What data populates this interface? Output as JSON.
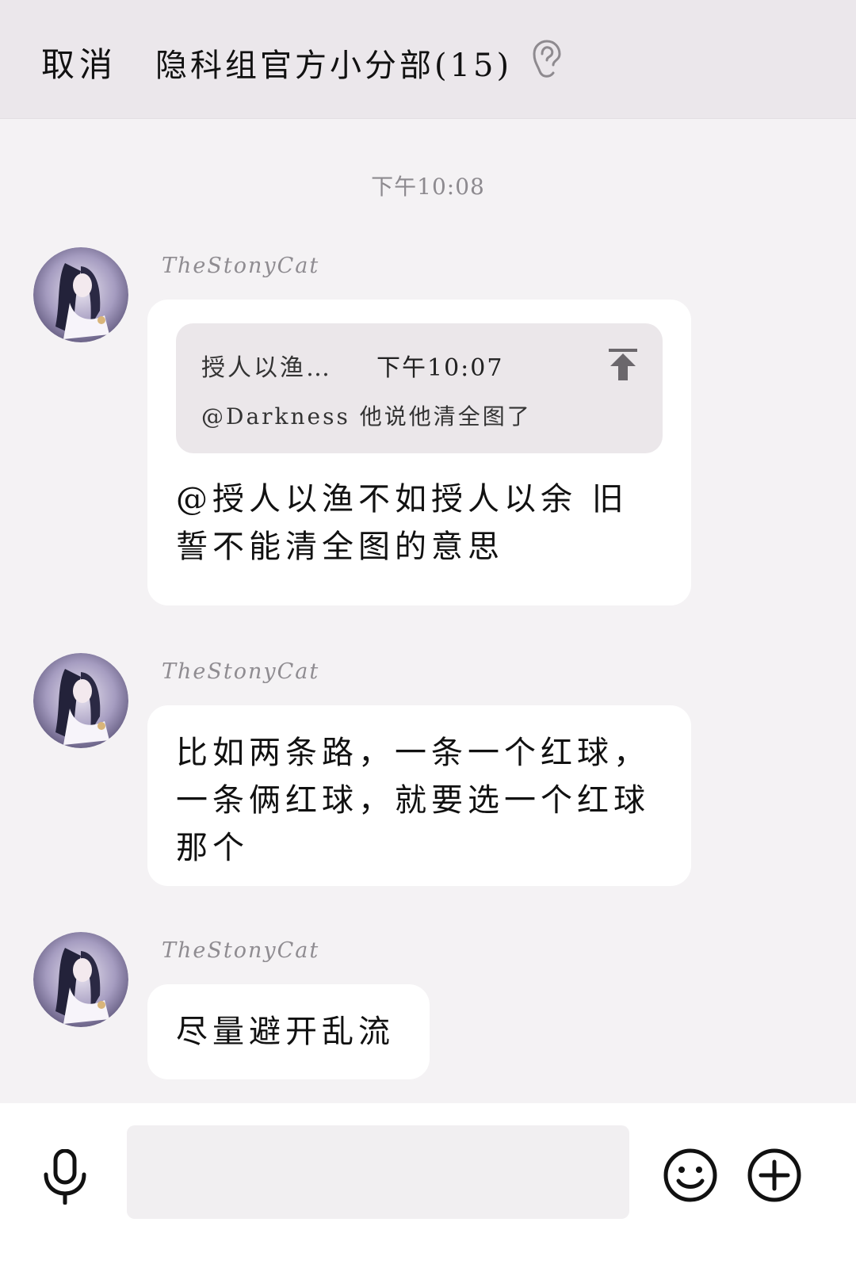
{
  "header": {
    "cancel_label": "取消",
    "title": "隐科组官方小分部(15)",
    "ear_icon": "ear-icon"
  },
  "timestamp": "下午10:08",
  "messages": [
    {
      "sender": "TheStonyCat",
      "quote": {
        "name": "授人以渔…",
        "time": "下午10:07",
        "text": "@Darkness 他说他清全图了"
      },
      "text": "@授人以渔不如授人以余 旧誓不能清全图的意思"
    },
    {
      "sender": "TheStonyCat",
      "text": "比如两条路，一条一个红球，一条俩红球，就要选一个红球那个"
    },
    {
      "sender": "TheStonyCat",
      "text": "尽量避开乱流"
    }
  ],
  "input": {
    "value": "",
    "placeholder": ""
  },
  "icons": {
    "mic": "microphone-icon",
    "emoji": "smiley-icon",
    "plus": "plus-circle-icon",
    "jump": "jump-to-top-icon"
  }
}
